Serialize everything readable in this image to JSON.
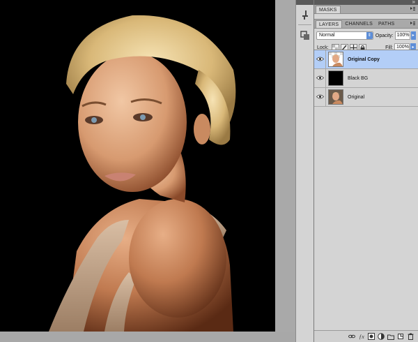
{
  "panels_top": {
    "tabs": [
      {
        "label": "MASKS",
        "active": true
      }
    ]
  },
  "layers_panel": {
    "tabs": [
      {
        "label": "LAYERS",
        "active": true
      },
      {
        "label": "CHANNELS",
        "active": false
      },
      {
        "label": "PATHS",
        "active": false
      }
    ],
    "blend_mode": "Normal",
    "opacity_label": "Opacity:",
    "opacity_value": "100%",
    "lock_label": "Lock:",
    "fill_label": "Fill:",
    "fill_value": "100%",
    "layers": [
      {
        "name": "Original Copy",
        "selected": true,
        "thumb": "portrait-transparent"
      },
      {
        "name": "Black BG",
        "selected": false,
        "thumb": "black"
      },
      {
        "name": "Original",
        "selected": false,
        "thumb": "portrait"
      }
    ],
    "footer_icons": [
      "link-layers-icon",
      "fx-icon",
      "add-mask-icon",
      "adjustment-layer-icon",
      "new-group-icon",
      "new-layer-icon",
      "trash-icon"
    ]
  },
  "colors": {
    "selection": "#b3cef7",
    "accent": "#5d8ed8",
    "canvas_bg": "#000000"
  }
}
